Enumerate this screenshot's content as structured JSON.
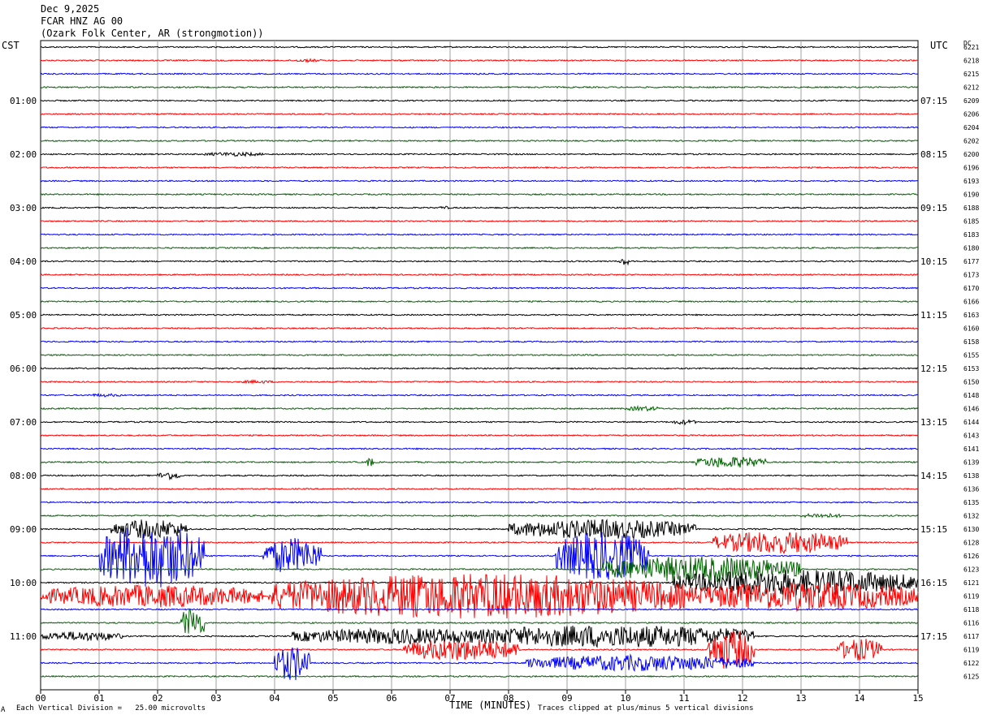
{
  "header": {
    "date": "Dec 9,2025",
    "station": "FCAR HNZ AG 00",
    "location": "(Ozark Folk Center, AR (strongmotion))"
  },
  "left_tz": "CST",
  "right_tz": "UTC",
  "dc_label": "DC",
  "footer": {
    "scale_note": "Each Vertical Division =   25.00 microvolts",
    "clip_note": "Traces clipped at plus/minus 5 vertical divisions",
    "corner_mark": "A"
  },
  "chart_data": {
    "type": "line",
    "title": "",
    "xlabel": "TIME (MINUTES)",
    "x_ticks": [
      "00",
      "01",
      "02",
      "03",
      "04",
      "05",
      "06",
      "07",
      "08",
      "09",
      "10",
      "11",
      "12",
      "13",
      "14",
      "15"
    ],
    "xlim": [
      0,
      15
    ],
    "trace_colors": [
      "#000000",
      "#ff0000",
      "#0000ff",
      "#006400"
    ],
    "left_time_labels": [
      {
        "trace": 4,
        "label": "01:00"
      },
      {
        "trace": 8,
        "label": "02:00"
      },
      {
        "trace": 12,
        "label": "03:00"
      },
      {
        "trace": 16,
        "label": "04:00"
      },
      {
        "trace": 20,
        "label": "05:00"
      },
      {
        "trace": 24,
        "label": "06:00"
      },
      {
        "trace": 28,
        "label": "07:00"
      },
      {
        "trace": 32,
        "label": "08:00"
      },
      {
        "trace": 36,
        "label": "09:00"
      },
      {
        "trace": 40,
        "label": "10:00"
      },
      {
        "trace": 44,
        "label": "11:00"
      }
    ],
    "right_time_labels": [
      {
        "trace": 4,
        "label": "07:15"
      },
      {
        "trace": 8,
        "label": "08:15"
      },
      {
        "trace": 12,
        "label": "09:15"
      },
      {
        "trace": 16,
        "label": "10:15"
      },
      {
        "trace": 20,
        "label": "11:15"
      },
      {
        "trace": 24,
        "label": "12:15"
      },
      {
        "trace": 28,
        "label": "13:15"
      },
      {
        "trace": 32,
        "label": "14:15"
      },
      {
        "trace": 36,
        "label": "15:15"
      },
      {
        "trace": 40,
        "label": "16:15"
      },
      {
        "trace": 44,
        "label": "17:15"
      }
    ],
    "dc_offsets": [
      "6221",
      "6218",
      "6215",
      "6212",
      "6209",
      "6206",
      "6204",
      "6202",
      "6200",
      "6196",
      "6193",
      "6190",
      "6188",
      "6185",
      "6183",
      "6180",
      "6177",
      "6173",
      "6170",
      "6166",
      "6163",
      "6160",
      "6158",
      "6155",
      "6153",
      "6150",
      "6148",
      "6146",
      "6144",
      "6143",
      "6141",
      "6139",
      "6138",
      "6136",
      "6135",
      "6132",
      "6130",
      "6128",
      "6126",
      "6123",
      "6121",
      "6119",
      "6118",
      "6116",
      "6117",
      "6119",
      "6122",
      "6125"
    ],
    "activity": [
      {
        "trace": 1,
        "start_min": 4.3,
        "end_min": 4.8,
        "amp": 2
      },
      {
        "trace": 8,
        "start_min": 2.8,
        "end_min": 3.8,
        "amp": 2.5
      },
      {
        "trace": 12,
        "start_min": 6.8,
        "end_min": 7.0,
        "amp": 2
      },
      {
        "trace": 16,
        "start_min": 9.9,
        "end_min": 10.05,
        "amp": 6
      },
      {
        "trace": 25,
        "start_min": 3.4,
        "end_min": 4.0,
        "amp": 2
      },
      {
        "trace": 26,
        "start_min": 0.8,
        "end_min": 1.4,
        "amp": 2
      },
      {
        "trace": 27,
        "start_min": 10.0,
        "end_min": 10.6,
        "amp": 3
      },
      {
        "trace": 28,
        "start_min": 10.8,
        "end_min": 11.2,
        "amp": 3
      },
      {
        "trace": 31,
        "start_min": 5.55,
        "end_min": 5.7,
        "amp": 6
      },
      {
        "trace": 31,
        "start_min": 11.2,
        "end_min": 12.4,
        "amp": 7
      },
      {
        "trace": 32,
        "start_min": 2.0,
        "end_min": 2.4,
        "amp": 5
      },
      {
        "trace": 35,
        "start_min": 13.0,
        "end_min": 13.7,
        "amp": 3
      },
      {
        "trace": 36,
        "start_min": 1.2,
        "end_min": 2.5,
        "amp": 12
      },
      {
        "trace": 36,
        "start_min": 8.0,
        "end_min": 11.2,
        "amp": 12
      },
      {
        "trace": 37,
        "start_min": 11.5,
        "end_min": 13.8,
        "amp": 14
      },
      {
        "trace": 38,
        "start_min": 1.0,
        "end_min": 2.8,
        "amp": 40
      },
      {
        "trace": 38,
        "start_min": 3.8,
        "end_min": 4.8,
        "amp": 22
      },
      {
        "trace": 38,
        "start_min": 8.8,
        "end_min": 10.4,
        "amp": 30
      },
      {
        "trace": 39,
        "start_min": 9.6,
        "end_min": 13.0,
        "amp": 16
      },
      {
        "trace": 40,
        "start_min": 10.8,
        "end_min": 15.0,
        "amp": 16
      },
      {
        "trace": 41,
        "start_min": 0.0,
        "end_min": 3.8,
        "amp": 14
      },
      {
        "trace": 41,
        "start_min": 3.9,
        "end_min": 11.0,
        "amp": 28
      },
      {
        "trace": 41,
        "start_min": 11.0,
        "end_min": 15.0,
        "amp": 18
      },
      {
        "trace": 43,
        "start_min": 2.4,
        "end_min": 2.8,
        "amp": 20
      },
      {
        "trace": 44,
        "start_min": 0.0,
        "end_min": 1.4,
        "amp": 6
      },
      {
        "trace": 44,
        "start_min": 4.3,
        "end_min": 8.2,
        "amp": 10
      },
      {
        "trace": 44,
        "start_min": 7.3,
        "end_min": 12.2,
        "amp": 14
      },
      {
        "trace": 45,
        "start_min": 6.2,
        "end_min": 8.2,
        "amp": 14
      },
      {
        "trace": 45,
        "start_min": 11.4,
        "end_min": 12.2,
        "amp": 25
      },
      {
        "trace": 45,
        "start_min": 13.6,
        "end_min": 14.4,
        "amp": 14
      },
      {
        "trace": 46,
        "start_min": 4.0,
        "end_min": 4.6,
        "amp": 22
      },
      {
        "trace": 46,
        "start_min": 8.3,
        "end_min": 12.2,
        "amp": 10
      }
    ]
  }
}
